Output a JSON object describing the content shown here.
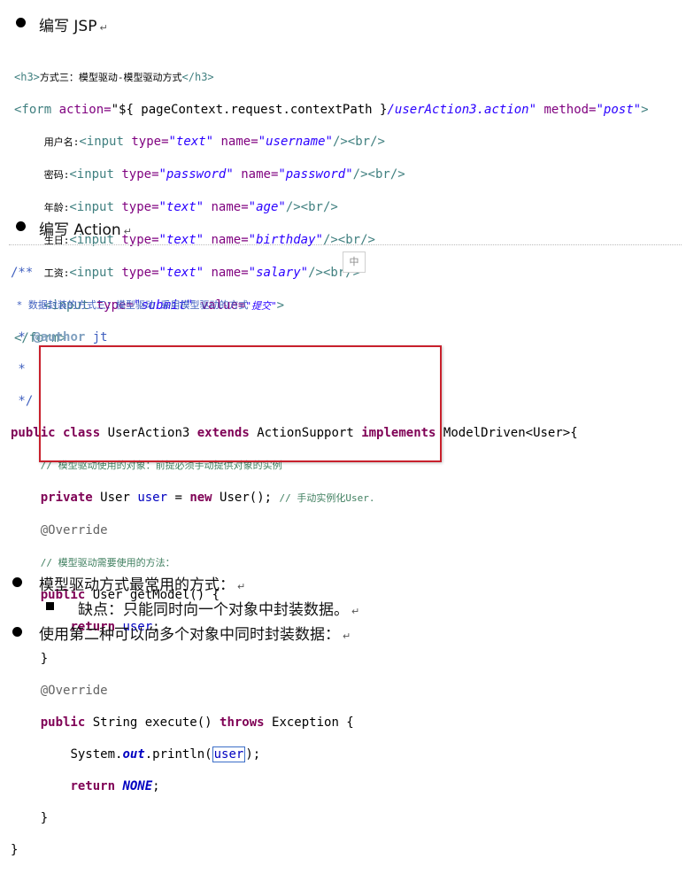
{
  "sections": {
    "jsp_heading": "编写 JSP",
    "action_heading": "编写 Action"
  },
  "jsp_code": {
    "h3_open": "<h3>",
    "h3_text": "方式三：模型驱动-模型驱动方式",
    "h3_close": "</h3>",
    "form_open": "<form",
    "form_action_attr": " action=",
    "form_action_val1": "\"${ pageContext.request.contextPath }",
    "form_action_val2": "/userAction3.action\"",
    "form_method_attr": " method=",
    "form_method_val": "\"post\"",
    "form_gt": ">",
    "fields": [
      {
        "label": "用户名:",
        "type": "\"text\"",
        "name": "\"username\""
      },
      {
        "label": "密码:",
        "type": "\"password\"",
        "name": "\"password\""
      },
      {
        "label": "年龄:",
        "type": "\"text\"",
        "name": "\"age\""
      },
      {
        "label": "生日:",
        "type": "\"text\"",
        "name": "\"birthday\""
      },
      {
        "label": "工资:",
        "type": "\"text\"",
        "name": "\"salary\""
      }
    ],
    "input_open": "<input",
    "type_attr": " type=",
    "name_attr": " name=",
    "input_close": "/><br/>",
    "submit_type": "\"submit\"",
    "value_attr": " value=",
    "submit_value": "\"提交\"",
    "submit_close": ">",
    "form_close": "</form>"
  },
  "java_code": {
    "doc_open": "/**",
    "doc_line1": " * 数据封装的方式三：模型驱动-采用模型驱动的方式",
    "doc_author_star": " * ",
    "doc_author_tag": "@author",
    "doc_author_name": " jt",
    "doc_star": " *",
    "doc_close": " */",
    "kw_public": "public",
    "kw_class": "class",
    "kw_extends": "extends",
    "kw_implements": "implements",
    "kw_private": "private",
    "kw_new": "new",
    "kw_return": "return",
    "kw_throws": "throws",
    "class_name": " UserAction3 ",
    "super_name": " ActionSupport ",
    "iface_name": " ModelDriven<User>{",
    "cmt1": "// 模型驱动使用的对象：前提必须手动提供对象的实例",
    "field_type": " User ",
    "field_name": "user",
    "field_assign": " = ",
    "field_ctor": " User(); ",
    "field_cmt": "// 手动实例化User.",
    "override": "@Override",
    "cmt2": "// 模型驱动需要使用的方法：",
    "getmodel_sig": " User getModel() {",
    "return_user": "user",
    "semicolon": ";",
    "close_brace": "}",
    "execute_sig": " String execute() ",
    "exception": " Exception {",
    "sysout_a": "System.",
    "sysout_out": "out",
    "sysout_b": ".println(",
    "sysout_arg": "user",
    "sysout_c": ");",
    "none_const": "NONE"
  },
  "ime_indicator": "中",
  "notes": {
    "note1": "模型驱动方式最常用的方式：",
    "note1_sub": "缺点：只能同时向一个对象中封装数据。",
    "note2": "使用第二种可以向多个对象中同时封装数据："
  },
  "para_mark": "↵",
  "colors": {
    "highlight_border": "#c8202c",
    "keyword": "#7f0055",
    "comment": "#3f7f5f",
    "javadoc": "#3f5fbf",
    "field": "#0000c0",
    "tag": "#3f7f7f",
    "attribute": "#7f007f",
    "string": "#2a00ff"
  }
}
